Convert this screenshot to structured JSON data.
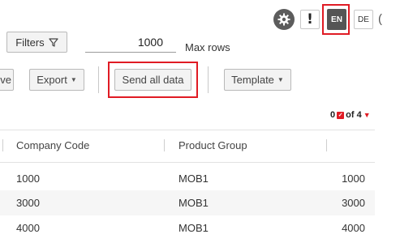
{
  "header": {
    "settings_icon": "gear-icon",
    "info_label": "!",
    "lang_active": "EN",
    "lang_other": "DE",
    "edge_char": "("
  },
  "filters": {
    "button_label": "Filters",
    "filter_icon": "funnel-icon",
    "max_rows_value": "1000",
    "max_rows_label": "Max rows"
  },
  "toolbar": {
    "remove_label": "ove",
    "export_label": "Export",
    "send_label": "Send all data",
    "template_label": "Template"
  },
  "counter": {
    "selected": "0",
    "of_text": "of 4",
    "accent": "#e01b24"
  },
  "table": {
    "columns": [
      "Company Code",
      "Product Group"
    ],
    "rows": [
      {
        "company_code": "1000",
        "product_group": "MOB1",
        "right_value": "1000"
      },
      {
        "company_code": "3000",
        "product_group": "MOB1",
        "right_value": "3000"
      },
      {
        "company_code": "4000",
        "product_group": "MOB1",
        "right_value": "4000"
      }
    ]
  },
  "colors": {
    "highlight": "#e01b24",
    "active_lang_bg": "#555555",
    "button_bg": "#f3f3f3"
  }
}
